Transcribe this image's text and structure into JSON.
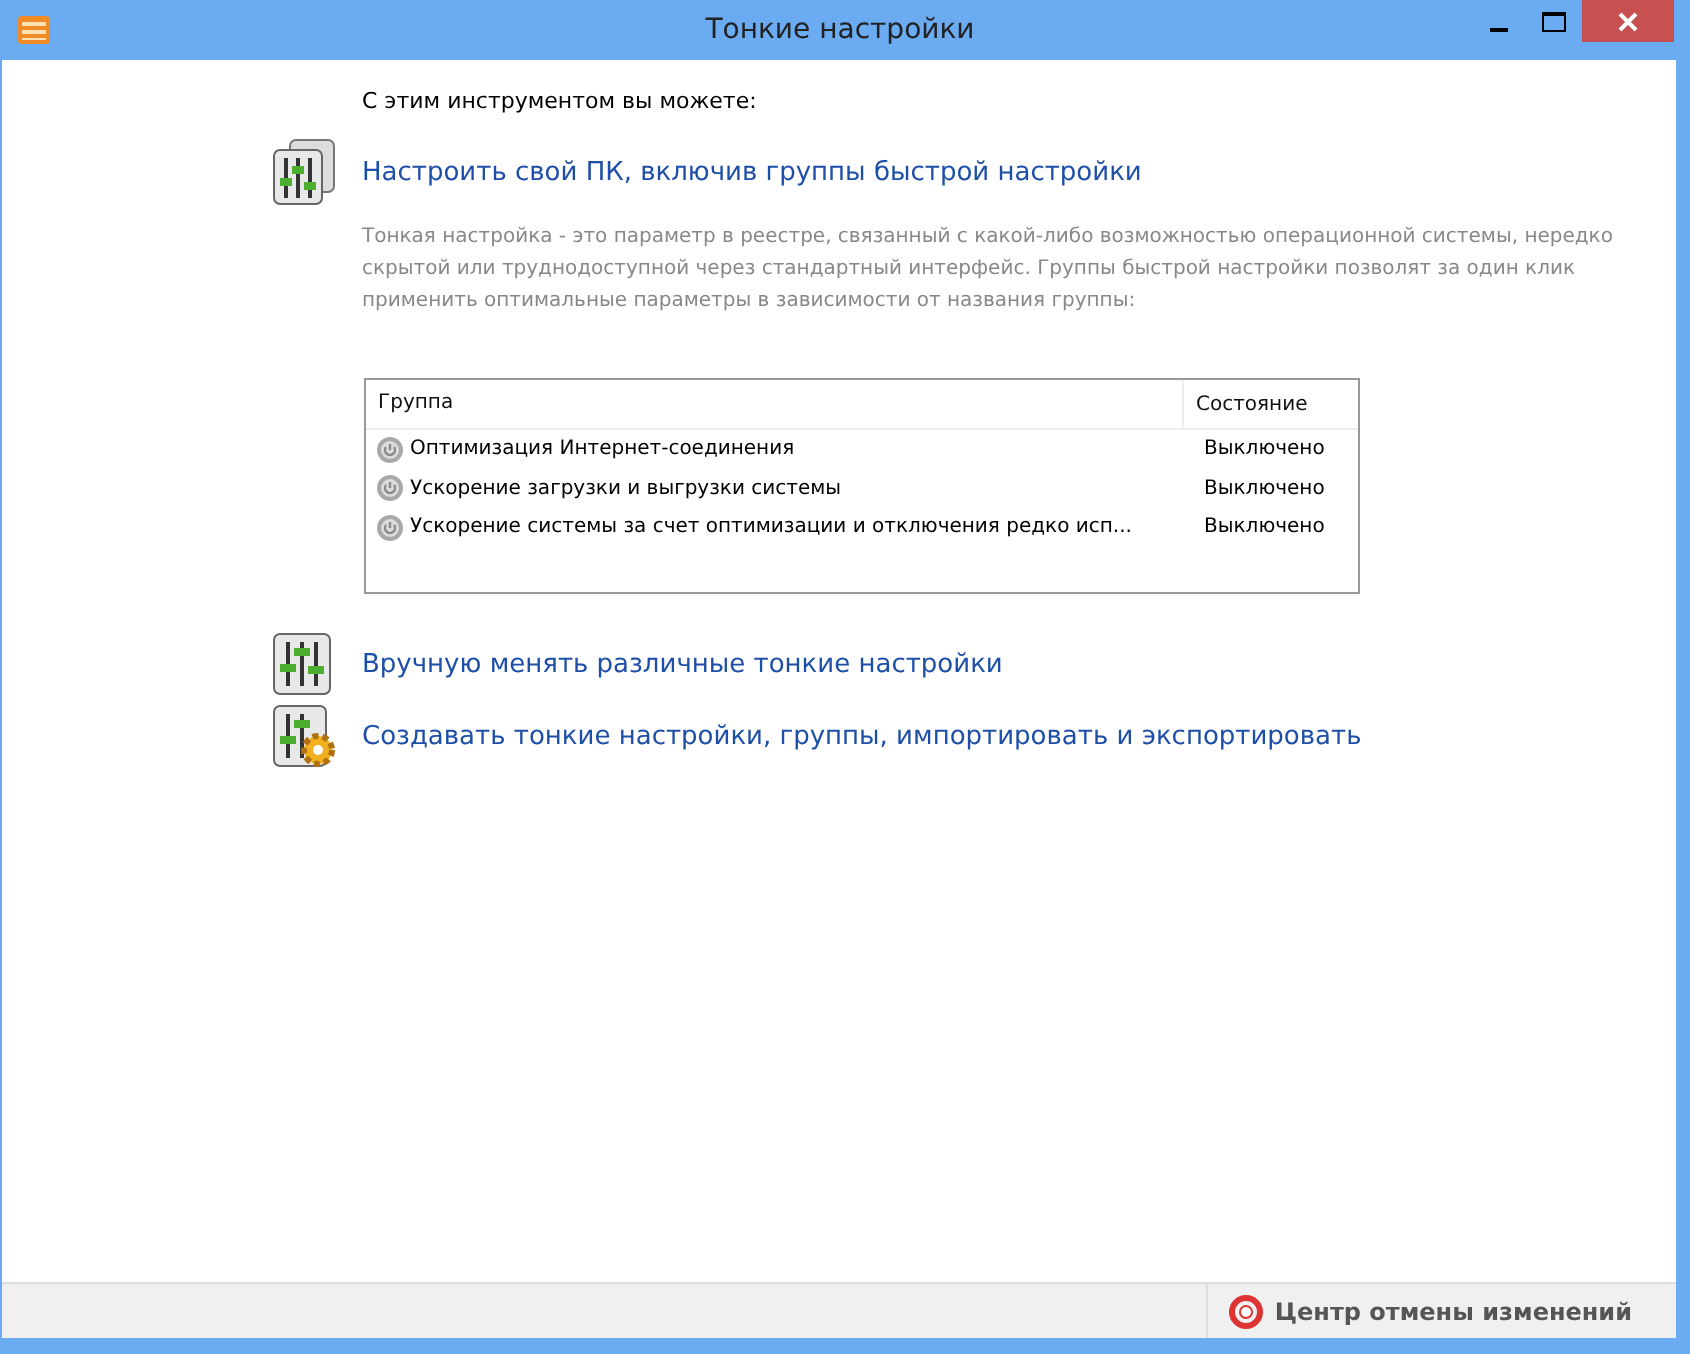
{
  "window": {
    "title": "Тонкие настройки"
  },
  "intro": "С этим инструментом вы можете:",
  "quick_setup": {
    "link": "Настроить свой ПК, включив группы быстрой настройки",
    "description": "Тонкая настройка - это параметр в реестре, связанный с какой-либо возможностью операционной системы, нередко скрытой или труднодоступной через стандартный интерфейс. Группы быстрой настройки позволят за один клик применить оптимальные параметры в зависимости от названия группы:",
    "table": {
      "columns": [
        "Группа",
        "Состояние"
      ],
      "rows": [
        {
          "group": "Оптимизация Интернет-соединения",
          "state": "Выключено"
        },
        {
          "group": "Ускорение загрузки и выгрузки системы",
          "state": "Выключено"
        },
        {
          "group": "Ускорение системы за счет оптимизации и отключения редко исп...",
          "state": "Выключено"
        }
      ]
    }
  },
  "links": [
    {
      "kind": "sliders",
      "text": "Вручную менять различные тонкие настройки"
    },
    {
      "kind": "sliders-gear",
      "text": "Создавать тонкие настройки, группы, импортировать и экспортировать"
    }
  ],
  "status_bar": {
    "button": "Центр отмены изменений"
  }
}
